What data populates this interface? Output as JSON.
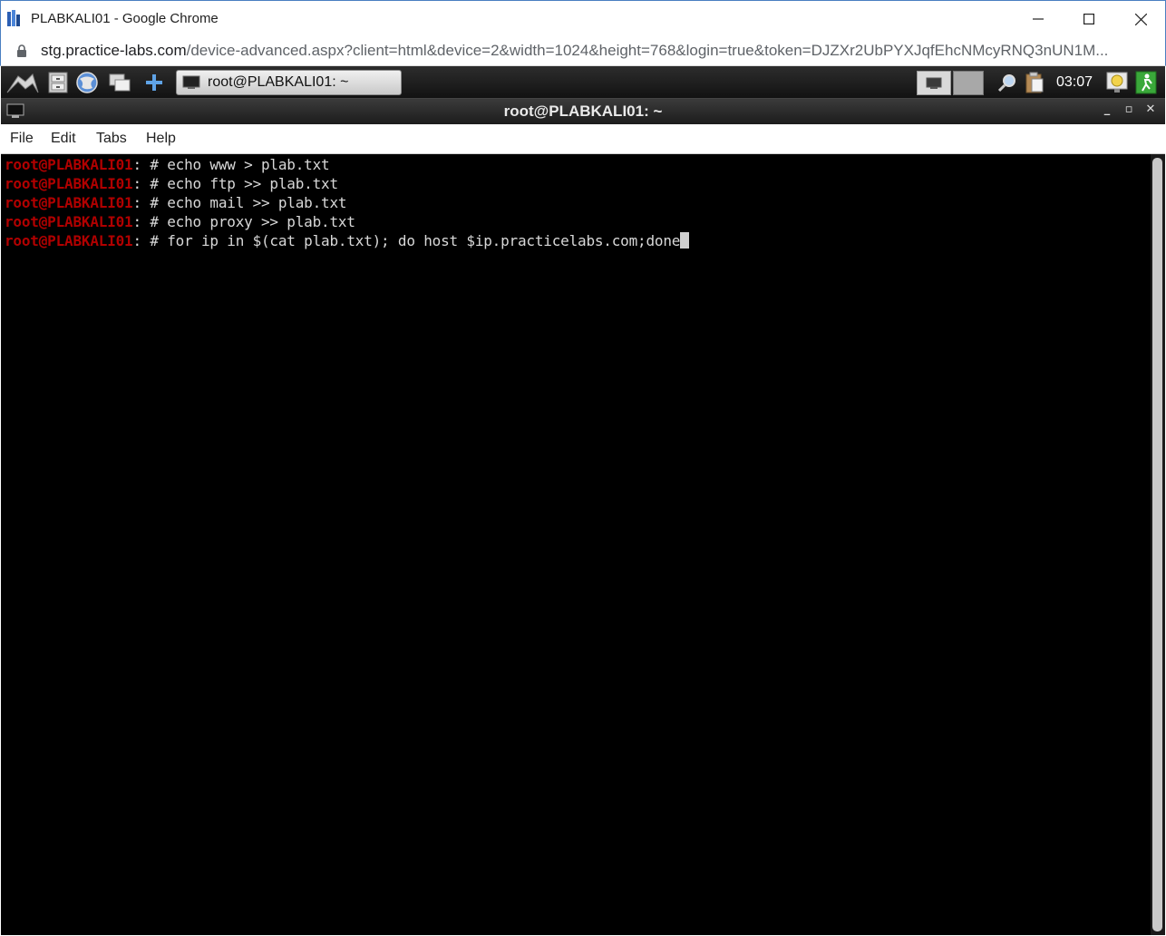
{
  "chrome": {
    "window_title": "PLABKALI01 - Google Chrome",
    "url_host": "stg.practice-labs.com",
    "url_path": "/device-advanced.aspx?client=html&device=2&width=1024&height=768&login=true&token=DJZXr2UbPYXJqfEhcNMcyRNQ3nUN1M..."
  },
  "panel": {
    "task_label": "root@PLABKALI01: ~",
    "clock": "03:07",
    "launchers": [
      "kali-dragon-icon",
      "file-cabinet-icon",
      "web-browser-icon",
      "window-manager-icon",
      "add-icon"
    ]
  },
  "terminal": {
    "title": "root@PLABKALI01: ~",
    "menu": [
      "File",
      "Edit",
      "Tabs",
      "Help"
    ],
    "prompt_user": "root@PLABKALI01",
    "prompt_sep": ": # ",
    "lines": [
      "echo www > plab.txt",
      "echo ftp >> plab.txt",
      "echo mail >> plab.txt",
      "echo proxy >> plab.txt",
      "for ip in $(cat plab.txt); do host $ip.practicelabs.com;done"
    ]
  },
  "colors": {
    "prompt": "#b00000",
    "terminal_bg": "#000000",
    "terminal_fg": "#d8d8d8",
    "chrome_border": "#4a7fc1"
  }
}
